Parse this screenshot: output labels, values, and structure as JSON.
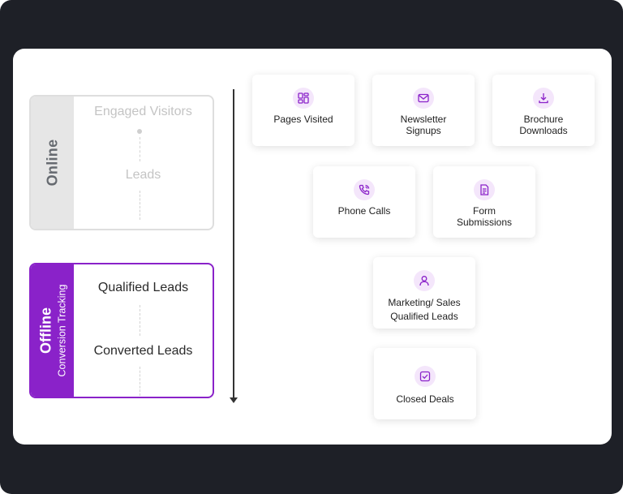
{
  "online": {
    "label": "Online",
    "steps": [
      "Engaged Visitors",
      "Leads"
    ]
  },
  "offline": {
    "label": "Offline",
    "sublabel": "Conversion Tracking",
    "steps": [
      "Qualified Leads",
      "Converted Leads"
    ]
  },
  "metrics": [
    {
      "label": "Pages Visited",
      "icon": "layout-icon"
    },
    {
      "label": "Newsletter Signups",
      "icon": "mail-icon"
    },
    {
      "label": "Brochure Downloads",
      "icon": "download-icon"
    },
    {
      "label": "Phone Calls",
      "icon": "phone-icon"
    },
    {
      "label": "Form Submissions",
      "icon": "form-icon"
    },
    {
      "label": "Marketing/ Sales Qualified Leads",
      "icon": "user-icon"
    },
    {
      "label": "Closed Deals",
      "icon": "check-square-icon"
    }
  ],
  "colors": {
    "accent": "#8a22c9",
    "frame": "#1e2027",
    "icon_bg": "#f4e6fb"
  }
}
